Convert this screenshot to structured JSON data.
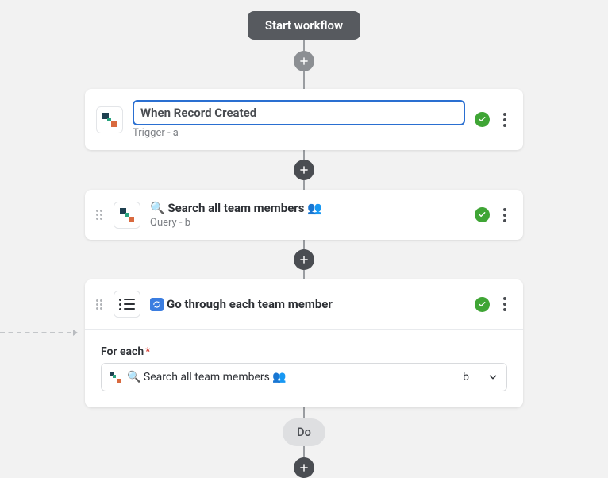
{
  "start_label": "Start workflow",
  "card1": {
    "title_value": "When Record Created",
    "subtitle": "Trigger - a"
  },
  "card2": {
    "title": "🔍 Search all team members 👥",
    "subtitle": "Query - b"
  },
  "card3": {
    "title": "Go through each team member",
    "field_label": "For each",
    "field_required": "*",
    "field_value": "🔍 Search all team members 👥",
    "field_ref": "b"
  },
  "do_label": "Do"
}
